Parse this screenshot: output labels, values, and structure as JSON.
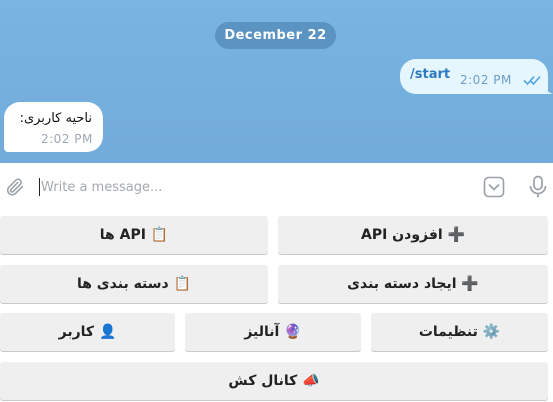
{
  "chat": {
    "date": "December 22",
    "outgoing": {
      "text": "/start",
      "time": "2:02 PM",
      "status": "read"
    },
    "incoming": {
      "text": "ناحیه کاربری:",
      "time": "2:02 PM"
    }
  },
  "composer": {
    "placeholder": "Write a message...",
    "value": "",
    "icons": [
      "paperclip-icon",
      "keyboard-toggle-icon",
      "microphone-icon"
    ]
  },
  "keyboard": {
    "rows": [
      [
        "➕ افزودن API",
        "📋 API ها"
      ],
      [
        "➕ ایجاد دسته بندی",
        "📋 دسته بندی ها"
      ],
      [
        "⚙️ تنظیمات",
        "🔮 آنالیز",
        "👤 کاربر"
      ],
      [
        "📣 کانال کش"
      ]
    ]
  },
  "colors": {
    "chat_background": "#72abd9",
    "outgoing_bubble": "#e6f6ff",
    "incoming_bubble": "#ffffff",
    "key_background": "#efefef",
    "accent": "#2b7bc0"
  }
}
